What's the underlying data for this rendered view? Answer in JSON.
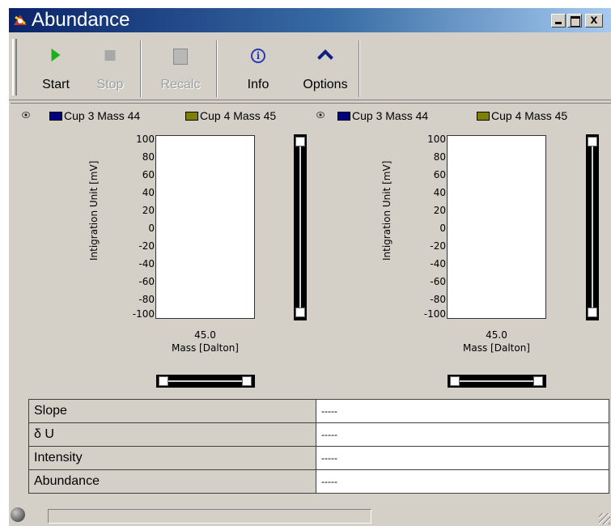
{
  "window": {
    "title": "Abundance"
  },
  "toolbar": {
    "start": "Start",
    "stop": "Stop",
    "recalc": "Recalc",
    "info": "Info",
    "options": "Options"
  },
  "panels": [
    {
      "legend": [
        {
          "label": "Cup 3 Mass 44",
          "color": "#000080"
        },
        {
          "label": "Cup 4 Mass 45",
          "color": "#808000"
        }
      ],
      "ylabel": "Intigration Unit [mV]",
      "yticks": [
        "100",
        "80",
        "60",
        "40",
        "20",
        "0",
        "-20",
        "-40",
        "-60",
        "-80",
        "-100"
      ],
      "xvalue": "45.0",
      "xlabel": "Mass [Dalton]"
    },
    {
      "legend": [
        {
          "label": "Cup 3 Mass 44",
          "color": "#000080"
        },
        {
          "label": "Cup 4 Mass 45",
          "color": "#808000"
        }
      ],
      "ylabel": "Intigration Unit [mV]",
      "yticks": [
        "100",
        "80",
        "60",
        "40",
        "20",
        "0",
        "-20",
        "-40",
        "-60",
        "-80",
        "-100"
      ],
      "xvalue": "45.0",
      "xlabel": "Mass [Dalton]"
    }
  ],
  "results": [
    {
      "label": "Slope",
      "value": "-----"
    },
    {
      "label": "δ U",
      "value": "-----"
    },
    {
      "label": "Intensity",
      "value": "-----"
    },
    {
      "label": "Abundance",
      "value": "-----"
    }
  ],
  "statusbar": {
    "progress": 0
  }
}
